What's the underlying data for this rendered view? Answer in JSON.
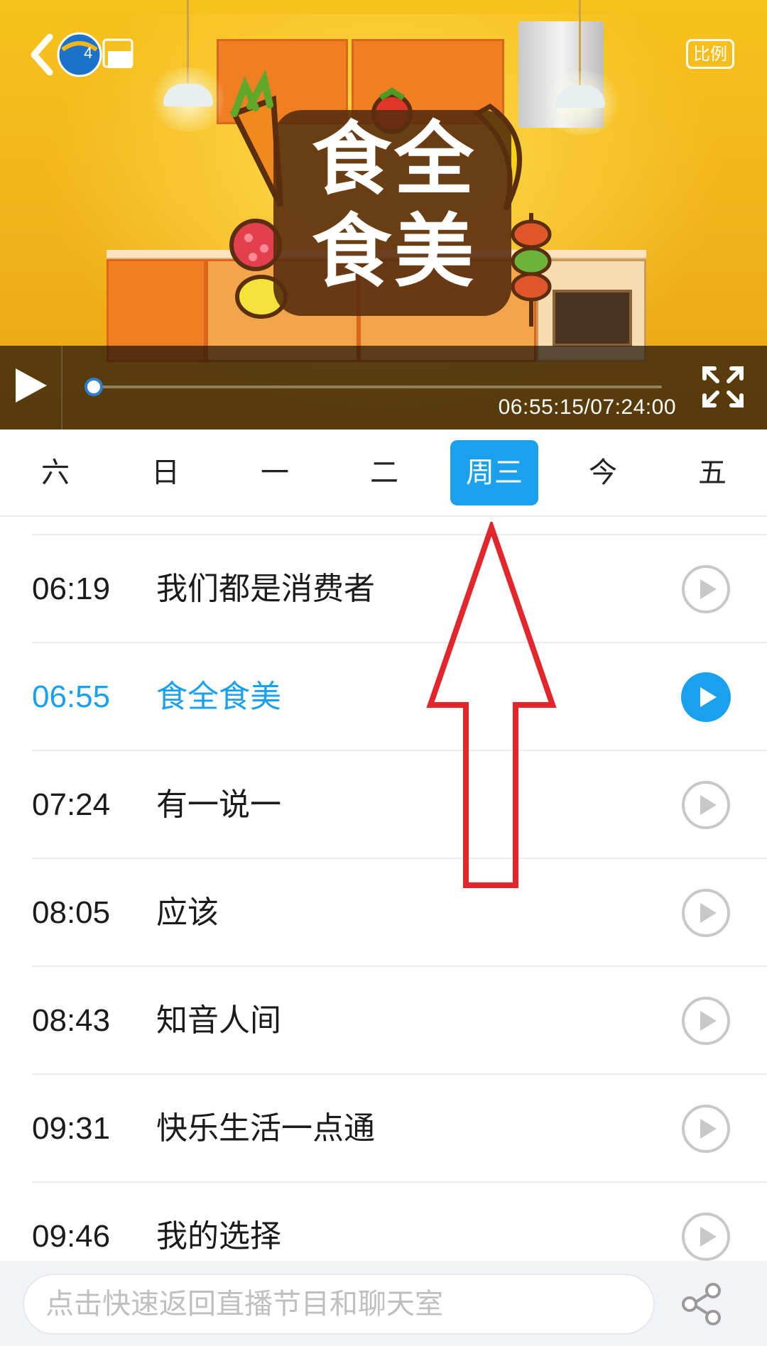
{
  "player": {
    "channel_badge_number": "4",
    "ratio_label": "比例",
    "time_current": "06:55:15",
    "time_total": "07:24:00",
    "time_display": "06:55:15/07:24:00",
    "progress_fraction": 0.0,
    "show_logo_line1": "食全",
    "show_logo_line2": "食美"
  },
  "day_tabs": [
    {
      "label": "六",
      "active": false
    },
    {
      "label": "日",
      "active": false
    },
    {
      "label": "一",
      "active": false
    },
    {
      "label": "二",
      "active": false
    },
    {
      "label": "周三",
      "active": true
    },
    {
      "label": "今",
      "active": false
    },
    {
      "label": "五",
      "active": false
    }
  ],
  "schedule": [
    {
      "time": "06:19",
      "title": "我们都是消费者",
      "active": false
    },
    {
      "time": "06:55",
      "title": "食全食美",
      "active": true
    },
    {
      "time": "07:24",
      "title": "有一说一",
      "active": false
    },
    {
      "time": "08:05",
      "title": "应该",
      "active": false
    },
    {
      "time": "08:43",
      "title": "知音人间",
      "active": false
    },
    {
      "time": "09:31",
      "title": "快乐生活一点通",
      "active": false
    },
    {
      "time": "09:46",
      "title": "我的选择",
      "active": false
    }
  ],
  "bottom_bar": {
    "chat_placeholder": "点击快速返回直播节目和聊天室"
  },
  "colors": {
    "accent": "#1aa0ec",
    "annotation": "#e3262b",
    "inactive_play": "#c8c8c8"
  },
  "icons": {
    "back": "chevron-left-icon",
    "play": "play-icon",
    "fullscreen": "expand-icon",
    "share": "share-icon",
    "row_play": "play-circle-icon"
  }
}
